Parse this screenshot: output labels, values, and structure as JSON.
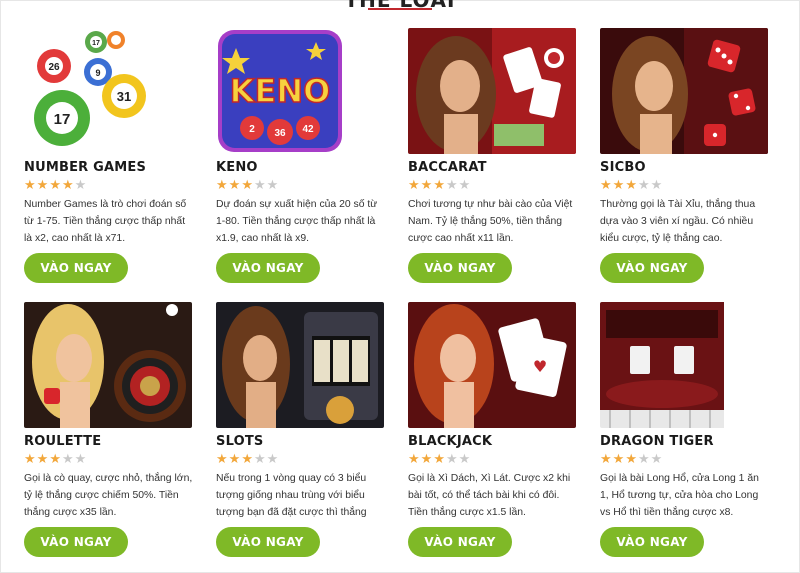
{
  "section": {
    "title": "THỂ LOẠI"
  },
  "games": [
    {
      "name": "NUMBER GAMES",
      "rating": 4,
      "description": "Number Games là trò chơi đoán số từ 1-75. Tiền thắng cược thấp nhất là x2, cao nhất là x71.",
      "button": "VÀO NGAY",
      "image_icon": "lottery-balls-icon"
    },
    {
      "name": "KENO",
      "rating": 3,
      "description": "Dự đoán sự xuất hiện của 20 số từ 1-80. Tiền thắng cược thấp nhất là x1.9, cao nhất là x9.",
      "button": "VÀO NGAY",
      "image_icon": "keno-logo-icon",
      "image_text": "KENO",
      "image_numbers": [
        "2",
        "36",
        "42"
      ]
    },
    {
      "name": "BACCARAT",
      "rating": 3,
      "description": "Chơi tương tự như bài cào của Việt Nam. Tỷ lệ thắng 50%, tiền thắng cược cao nhất x11 lần.",
      "button": "VÀO NGAY",
      "image_icon": "baccarat-cards-icon"
    },
    {
      "name": "SICBO",
      "rating": 3,
      "description": "Thường gọi là Tài Xỉu, thắng thua dựa vào 3 viên xí ngầu. Có nhiều kiểu cược, tỷ lệ thắng cao.",
      "button": "VÀO NGAY",
      "image_icon": "dice-icon"
    },
    {
      "name": "ROULETTE",
      "rating": 3,
      "description": "Gọi là cò quay, cược nhỏ, thắng lớn, tỷ lệ thắng cược chiếm 50%. Tiền thắng cược x35 lần.",
      "button": "VÀO NGAY",
      "image_icon": "roulette-wheel-icon"
    },
    {
      "name": "SLOTS",
      "rating": 3,
      "description": "Nếu trong 1 vòng quay có 3 biểu tượng giống nhau trùng với biểu tượng bạn đã đặt cược thì thắng cược.",
      "button": "VÀO NGAY",
      "image_icon": "slot-machine-icon"
    },
    {
      "name": "BLACKJACK",
      "rating": 3,
      "description": "Gọi là Xì Dách, Xì Lát. Cược x2 khi bài tốt, có thể tách bài khi có đôi. Tiền thắng cược x1.5 lần.",
      "button": "VÀO NGAY",
      "image_icon": "blackjack-cards-icon"
    },
    {
      "name": "DRAGON TIGER",
      "rating": 3,
      "description": "Gọi là bài Long Hổ, cửa Long 1 ăn 1, Hổ tương tự, cửa hòa cho Long vs Hổ thì tiền thắng cược x8.",
      "button": "VÀO NGAY",
      "image_icon": "dragon-tiger-table-icon"
    }
  ],
  "colors": {
    "button_green": "#7fb927",
    "star_on": "#f2a73b",
    "star_off": "#c9c9c9",
    "title_underline": "#c0272d"
  }
}
